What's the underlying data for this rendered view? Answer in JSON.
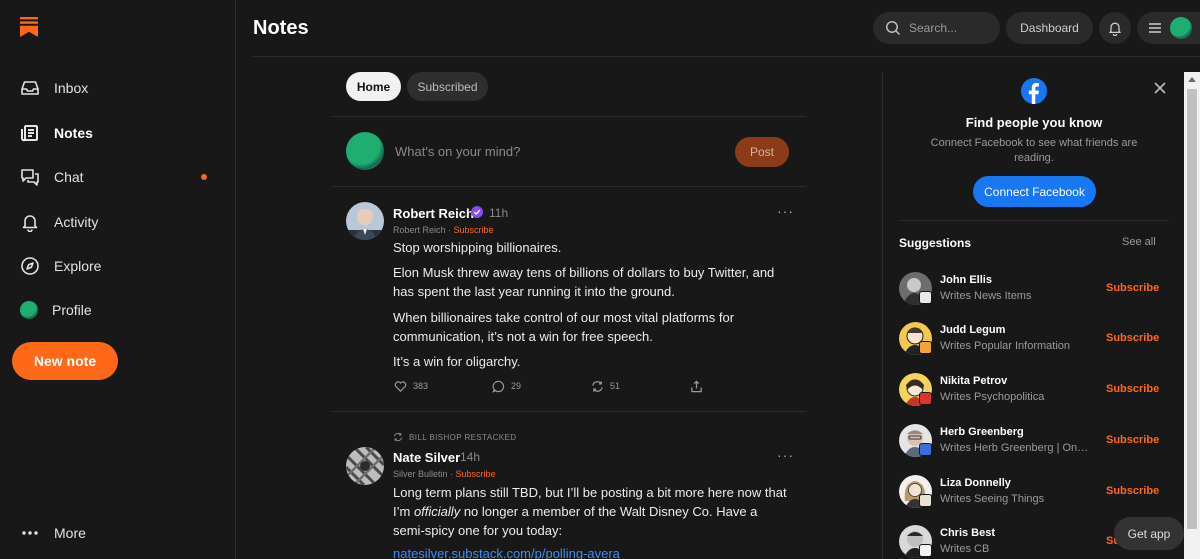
{
  "sidebar": {
    "items": [
      {
        "label": "Inbox",
        "icon": "inbox-icon"
      },
      {
        "label": "Notes",
        "icon": "notes-icon"
      },
      {
        "label": "Chat",
        "icon": "chat-icon"
      },
      {
        "label": "Activity",
        "icon": "bell-icon"
      },
      {
        "label": "Explore",
        "icon": "compass-icon"
      },
      {
        "label": "Profile",
        "icon": "profile-avatar"
      }
    ],
    "new_note_label": "New note",
    "more_label": "More"
  },
  "header": {
    "title": "Notes",
    "search_placeholder": "Search...",
    "dashboard_label": "Dashboard"
  },
  "tabs": [
    {
      "label": "Home",
      "active": true
    },
    {
      "label": "Subscribed",
      "active": false
    }
  ],
  "compose": {
    "placeholder": "What's on your mind?",
    "post_label": "Post"
  },
  "posts": [
    {
      "author": "Robert Reich",
      "time": "11h",
      "publication": "Robert Reich",
      "subscribe_label": "Subscribe",
      "paragraphs": [
        "Stop worshipping billionaires.",
        "Elon Musk threw away tens of billions of dollars to buy Twitter, and has spent the last year running it into the ground.",
        "When billionaires take control of our most vital platforms for communication, it’s not a win for free speech.",
        "It’s a win for oligarchy."
      ],
      "likes": "383",
      "comments": "29",
      "restacks": "51"
    },
    {
      "restack_label": "BILL BISHOP RESTACKED",
      "author": "Nate Silver",
      "time": "14h",
      "publication": "Silver Bulletin",
      "subscribe_label": "Subscribe",
      "text_before": "Long term plans still TBD, but I’ll be posting a bit more here now that I’m ",
      "text_em": "officially",
      "text_after": " no longer a member of the Walt Disney Co. Have a semi-spicy one for you today:",
      "link": "natesilver.substack.com/p/polling-avera"
    }
  ],
  "facebook": {
    "title": "Find people you know",
    "description": "Connect Facebook to see what friends are reading.",
    "button_label": "Connect Facebook",
    "brand_color": "#1877f2"
  },
  "suggestions": {
    "title": "Suggestions",
    "see_all_label": "See all",
    "subscribe_label": "Subscribe",
    "items": [
      {
        "name": "John Ellis",
        "desc": "Writes News Items",
        "badge_color": "#e9e9e9"
      },
      {
        "name": "Judd Legum",
        "desc": "Writes Popular Information",
        "badge_color": "#f2a33a"
      },
      {
        "name": "Nikita Petrov",
        "desc": "Writes Psychopolitica",
        "badge_color": "#d8382e"
      },
      {
        "name": "Herb Greenberg",
        "desc": "Writes Herb Greenberg | On t...",
        "badge_color": "#3a6fd8"
      },
      {
        "name": "Liza Donnelly",
        "desc": "Writes Seeing Things",
        "badge_color": "#e8e2d6"
      },
      {
        "name": "Chris Best",
        "desc": "Writes CB",
        "badge_color": "#f2f2f2"
      }
    ]
  },
  "get_app_label": "Get app",
  "colors": {
    "accent": "#ff6719",
    "background": "#181818",
    "link": "#3f8ef0"
  }
}
